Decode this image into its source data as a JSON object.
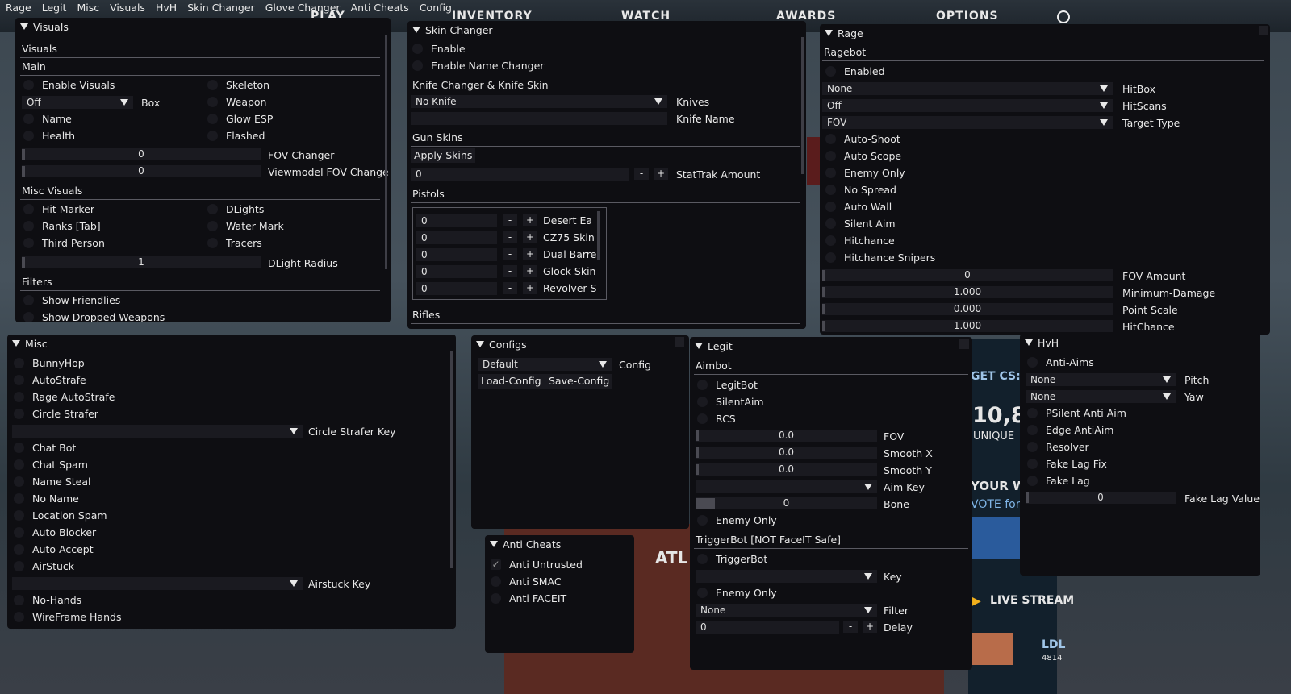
{
  "menubar": [
    "Rage",
    "Legit",
    "Misc",
    "Visuals",
    "HvH",
    "Skin Changer",
    "Glove Changer",
    "Anti Cheats",
    "Config"
  ],
  "background": {
    "nav": [
      "PLAY",
      "INVENTORY",
      "WATCH",
      "AWARDS",
      "OPTIONS"
    ],
    "get_csgo": "GET CS:G",
    "big_number": "10,8",
    "unique": "UNIQUE",
    "your_w": "YOUR W",
    "vote_for": "VOTE for",
    "live_stream": "LIVE STREAM",
    "ldl": "LDL",
    "ldl_num": "4814",
    "atl": "ATL"
  },
  "visuals": {
    "title": "Visuals",
    "header": "Visuals",
    "main": "Main",
    "enable_visuals": "Enable Visuals",
    "skeleton": "Skeleton",
    "box_value": "Off",
    "box_label": "Box",
    "weapon": "Weapon",
    "name": "Name",
    "glow_esp": "Glow ESP",
    "health": "Health",
    "flashed": "Flashed",
    "fov_changer_value": "0",
    "fov_changer": "FOV Changer",
    "viewmodel_value": "0",
    "viewmodel": "Viewmodel FOV Change",
    "misc_visuals": "Misc Visuals",
    "hit_marker": "Hit Marker",
    "dlights": "DLights",
    "ranks": "Ranks [Tab]",
    "water_mark": "Water Mark",
    "third_person": "Third Person",
    "tracers": "Tracers",
    "dlight_radius_value": "1",
    "dlight_radius": "DLight Radius",
    "filters": "Filters",
    "show_friendlies": "Show Friendlies",
    "show_dropped": "Show Dropped Weapons"
  },
  "skin": {
    "title": "Skin Changer",
    "enable": "Enable",
    "enable_name": "Enable Name Changer",
    "knife_header": "Knife Changer & Knife Skin",
    "knife_value": "No Knife",
    "knives": "Knives",
    "knife_name": "Knife Name",
    "gun_skins": "Gun Skins",
    "apply_skins": "Apply Skins",
    "stattrak_value": "0",
    "stattrak": "StatTrak Amount",
    "pistols": "Pistols",
    "pistol_rows": [
      {
        "value": "0",
        "name": "Desert Ea"
      },
      {
        "value": "0",
        "name": "CZ75 Skin"
      },
      {
        "value": "0",
        "name": "Dual Barre"
      },
      {
        "value": "0",
        "name": "Glock Skin"
      },
      {
        "value": "0",
        "name": "Revolver S"
      }
    ],
    "rifles": "Rifles",
    "minus": "-",
    "plus": "+"
  },
  "rage": {
    "title": "Rage",
    "ragebot": "Ragebot",
    "enabled": "Enabled",
    "hitbox_value": "None",
    "hitbox": "HitBox",
    "hitscans_value": "Off",
    "hitscans": "HitScans",
    "target_value": "FOV",
    "target": "Target Type",
    "checks": [
      "Auto-Shoot",
      "Auto Scope",
      "Enemy Only",
      "No Spread",
      "Auto Wall",
      "Silent Aim",
      "Hitchance",
      "Hitchance Snipers"
    ],
    "fov_amount_value": "0",
    "fov_amount": "FOV Amount",
    "min_damage_value": "1.000",
    "min_damage": "Minimum-Damage",
    "point_scale_value": "0.000",
    "point_scale": "Point Scale",
    "hitchance_value": "1.000",
    "hitchance": "HitChance"
  },
  "misc": {
    "title": "Misc",
    "items_a": [
      "BunnyHop",
      "AutoStrafe",
      "Rage AutoStrafe",
      "Circle Strafer"
    ],
    "circle_key": "Circle Strafer Key",
    "items_b": [
      "Chat Bot",
      "Chat Spam",
      "Name Steal",
      "No Name",
      "Location Spam",
      "Auto Blocker",
      "Auto Accept",
      "AirStuck"
    ],
    "airstuck_key": "Airstuck Key",
    "items_c": [
      "No-Hands",
      "WireFrame Hands"
    ]
  },
  "configs": {
    "title": "Configs",
    "config_value": "Default",
    "config": "Config",
    "load": "Load-Config",
    "save": "Save-Config"
  },
  "anticheats": {
    "title": "Anti Cheats",
    "untrusted": "Anti Untrusted",
    "smac": "Anti SMAC",
    "faceit": "Anti FACEIT",
    "check": "✓"
  },
  "legit": {
    "title": "Legit",
    "aimbot": "Aimbot",
    "legitbot": "LegitBot",
    "silentaim": "SilentAim",
    "rcs": "RCS",
    "fov_value": "0.0",
    "fov": "FOV",
    "smooth_x_value": "0.0",
    "smooth_x": "Smooth X",
    "smooth_y_value": "0.0",
    "smooth_y": "Smooth Y",
    "aim_key": "Aim Key",
    "bone_value": "0",
    "bone": "Bone",
    "enemy_only": "Enemy Only",
    "trigger_header": "TriggerBot [NOT FaceIT Safe]",
    "triggerbot": "TriggerBot",
    "key": "Key",
    "enemy_only_2": "Enemy Only",
    "filter_value": "None",
    "filter": "Filter",
    "delay_value": "0",
    "delay": "Delay"
  },
  "hvh": {
    "title": "HvH",
    "anti_aims": "Anti-Aims",
    "pitch_value": "None",
    "pitch": "Pitch",
    "yaw_value": "None",
    "yaw": "Yaw",
    "items": [
      "PSilent Anti Aim",
      "Edge AntiAim",
      "Resolver",
      "Fake Lag Fix",
      "Fake Lag"
    ],
    "fake_lag_value_value": "0",
    "fake_lag_value": "Fake Lag Value"
  }
}
